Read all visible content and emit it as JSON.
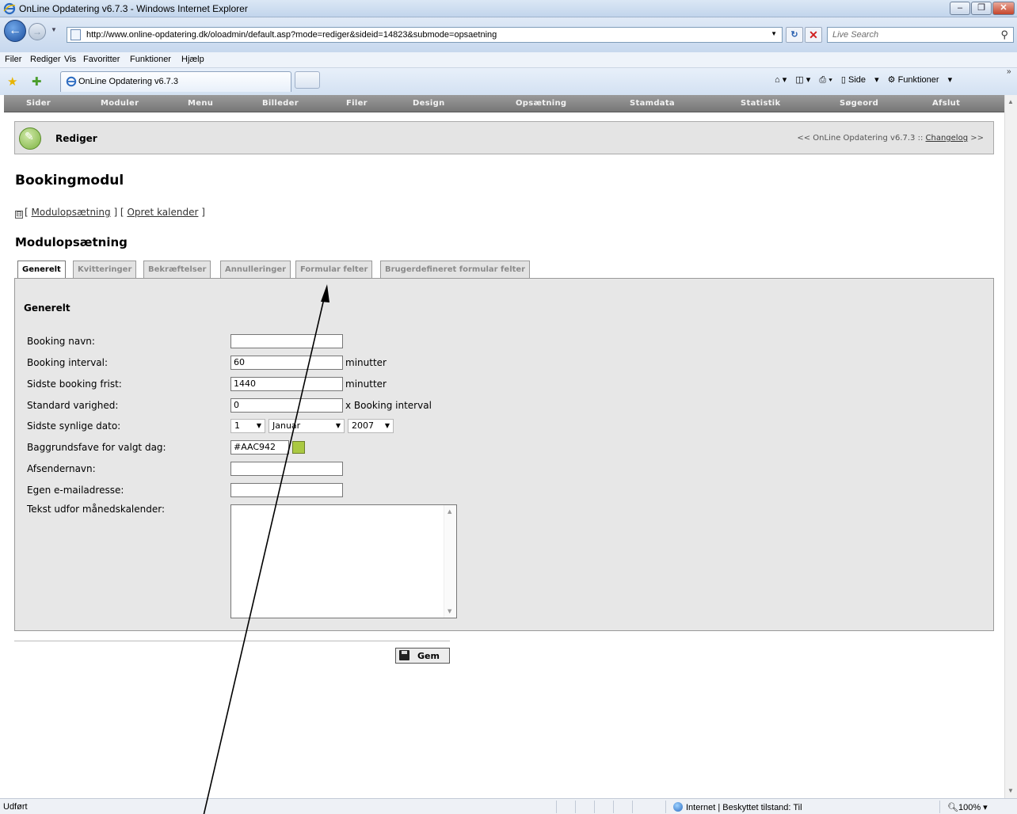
{
  "browser": {
    "window_title": "OnLine Opdatering v6.7.3 - Windows Internet Explorer",
    "url": "http://www.online-opdatering.dk/oloadmin/default.asp?mode=rediger&sideid=14823&submode=opsaetning",
    "search_placeholder": "Live Search",
    "menu": [
      "Filer",
      "Rediger",
      "Vis",
      "Favoritter",
      "Funktioner",
      "Hjælp"
    ],
    "tab_title": "OnLine Opdatering v6.7.3",
    "tools": {
      "side": "Side",
      "funktioner": "Funktioner"
    },
    "status_text": "Udført",
    "zone_text": "Internet | Beskyttet tilstand: Til",
    "zoom_text": "100%"
  },
  "app": {
    "nav": [
      "Sider",
      "Moduler",
      "Menu",
      "Billeder",
      "Filer",
      "Design",
      "Opsætning",
      "Stamdata",
      "Statistik",
      "Søgeord",
      "Afslut"
    ],
    "rediger_label": "Rediger",
    "version_prefix": "<< OnLine Opdatering v6.7.3 ::",
    "changelog_label": "Changelog",
    "version_suffix": ">>",
    "heading": "Bookingmodul",
    "sublinks": {
      "toggle": "⊟",
      "modulopsaetning": "Modulopsætning",
      "opret_kalender": "Opret kalender"
    },
    "section_heading": "Modulopsætning",
    "tabs": [
      "Generelt",
      "Kvitteringer",
      "Bekræftelser",
      "Annulleringer",
      "Formular felter",
      "Brugerdefineret formular felter"
    ],
    "active_tab": "Generelt",
    "panel_title": "Generelt",
    "form": {
      "booking_navn_label": "Booking navn:",
      "booking_navn_value": "",
      "booking_interval_label": "Booking interval:",
      "booking_interval_value": "60",
      "booking_interval_unit": "minutter",
      "sidste_frist_label": "Sidste booking frist:",
      "sidste_frist_value": "1440",
      "sidste_frist_unit": "minutter",
      "standard_varighed_label": "Standard varighed:",
      "standard_varighed_value": "0",
      "standard_varighed_unit": "x Booking interval",
      "sidste_dato_label": "Sidste synlige dato:",
      "dato_day": "1",
      "dato_month": "Januar",
      "dato_year": "2007",
      "baggrund_label": "Baggrundsfave for valgt dag:",
      "baggrund_value": "#AAC942",
      "afsender_label": "Afsendernavn:",
      "afsender_value": "",
      "email_label": "Egen e-mailadresse:",
      "email_value": "",
      "tekst_label": "Tekst udfor månedskalender:"
    },
    "save_label": "Gem"
  },
  "colors": {
    "swatch": "#AAC942",
    "nav_bg": "#888888"
  }
}
